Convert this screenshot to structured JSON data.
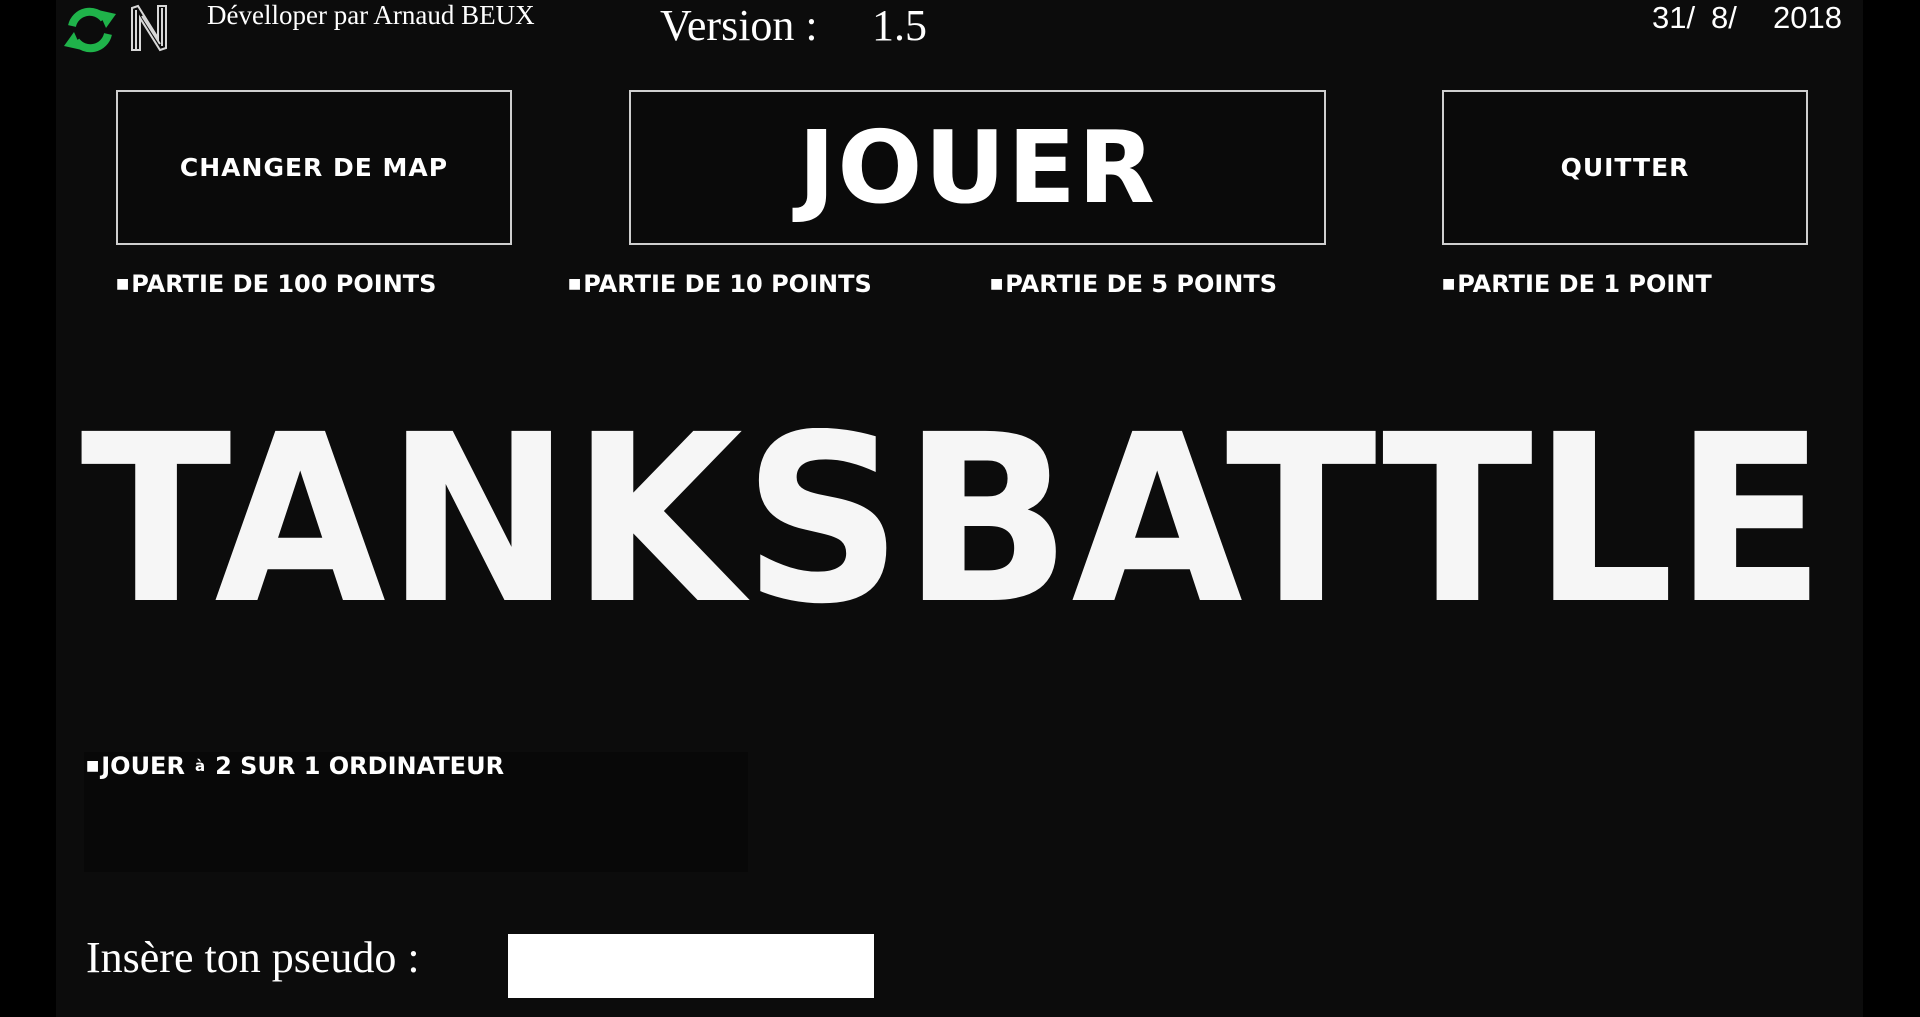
{
  "header": {
    "credit": "Dévelloper par Arnaud BEUX",
    "version_label": "Version :",
    "version_value": "1.5",
    "date_day": "31/",
    "date_month": "8/",
    "date_year": "2018"
  },
  "buttons": {
    "change_map": "Changer de map",
    "play": "jouer",
    "quit": "Quitter"
  },
  "match_options": [
    {
      "label": "Partie de 100 points"
    },
    {
      "label": "Partie de 10 points"
    },
    {
      "label": "Partie de 5 points"
    },
    {
      "label": "Partie de 1 point"
    }
  ],
  "title": "TANKSBATTLE",
  "two_player": {
    "part1": "Jouer",
    "part2": "à",
    "part3": "2 sur 1 ordinateur"
  },
  "pseudo": {
    "label": "Insère ton pseudo :",
    "value": "",
    "placeholder": ""
  },
  "colors": {
    "background": "#000000",
    "panel": "#0c0c0c",
    "text": "#ffffff",
    "refresh_icon": "#1fb34a",
    "button_border": "#cfcfcf"
  },
  "icons": {
    "refresh": "refresh-icon",
    "logo": "n-logo-icon",
    "bullet": "square-bullet"
  }
}
